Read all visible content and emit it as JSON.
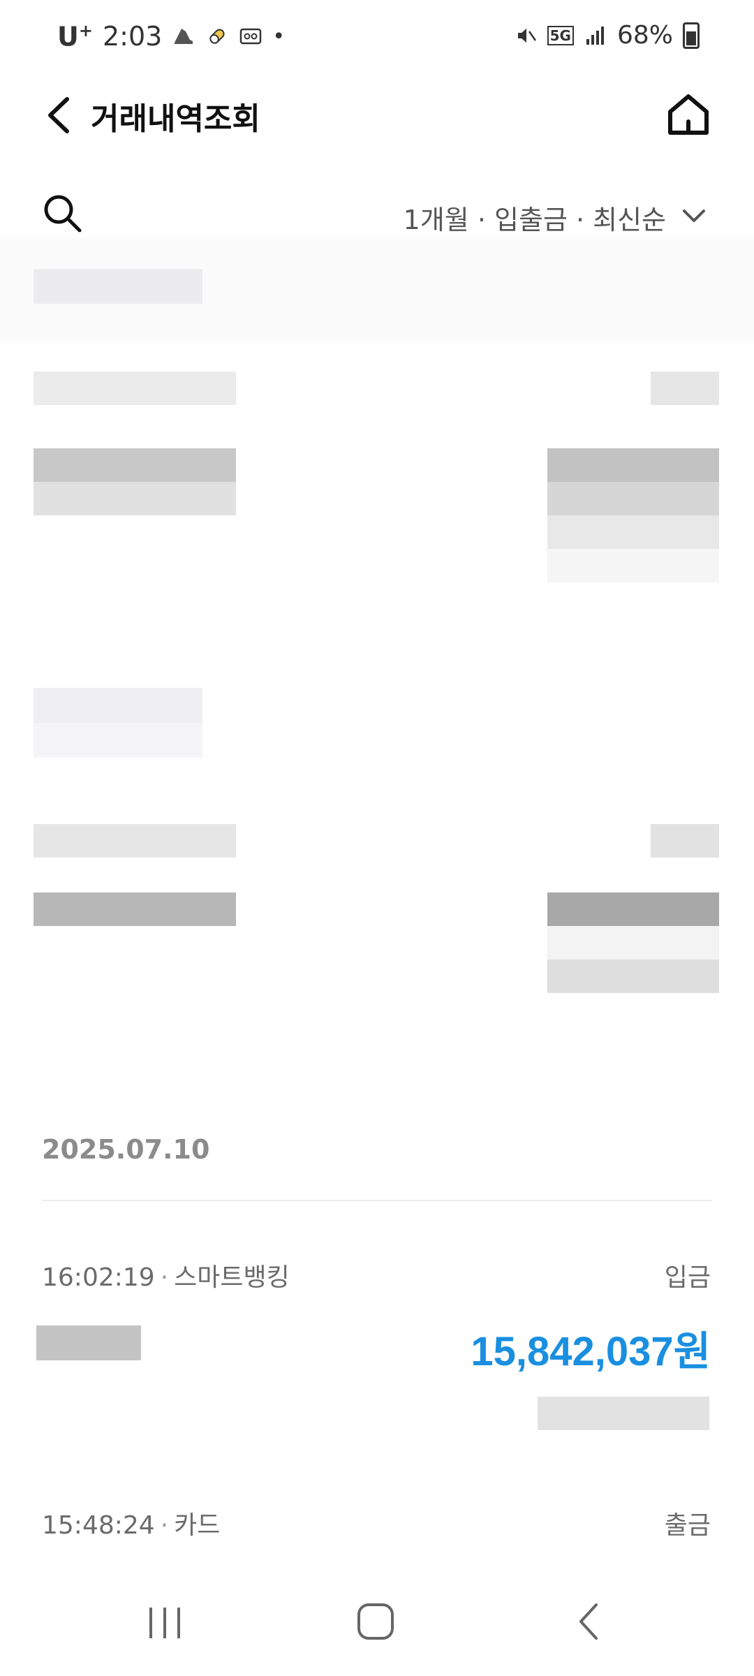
{
  "status_bar": {
    "carrier": "U",
    "carrier_sup": "+",
    "time": "2:03",
    "dot": "•",
    "network": "5G",
    "battery": "68%"
  },
  "header": {
    "title": "거래내역조회"
  },
  "filter": {
    "label": "1개월 · 입출금 · 최신순"
  },
  "date_group": "2025.07.10",
  "transactions": [
    {
      "time": "16:02:19",
      "sep": "·",
      "channel": "스마트뱅킹",
      "type": "입금",
      "amount": "15,842,037원"
    },
    {
      "time": "15:48:24",
      "sep": "·",
      "channel": "카드",
      "type": "출금"
    }
  ],
  "colors": {
    "accent": "#1a8fe0",
    "muted": "#8b8b8b",
    "text": "#111111"
  },
  "icons": [
    "back-icon",
    "home-icon",
    "search-icon",
    "chevron-down-icon",
    "nav-recents-icon",
    "nav-home-icon",
    "nav-back-icon"
  ]
}
